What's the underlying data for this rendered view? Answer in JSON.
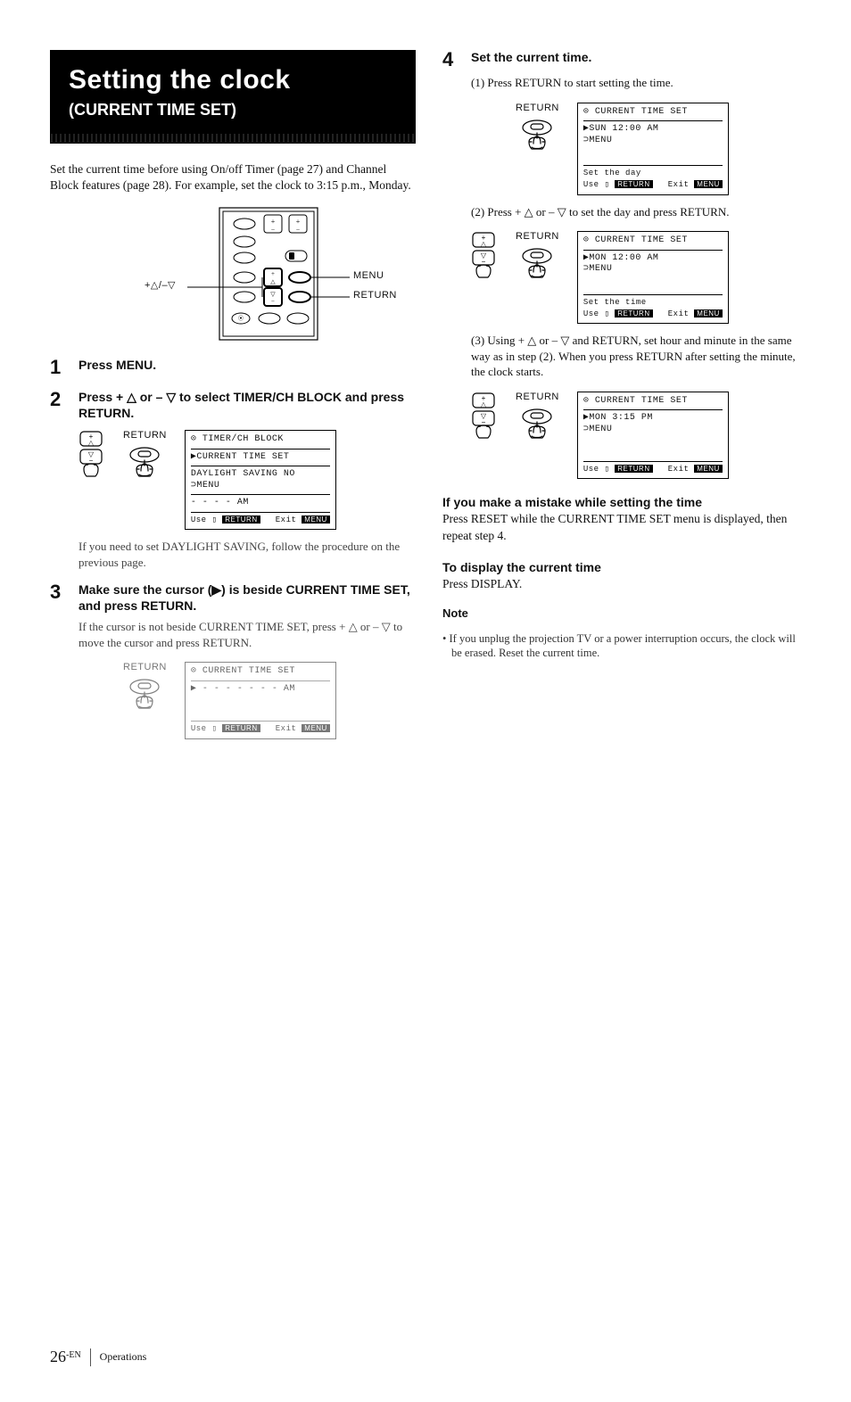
{
  "banner": {
    "title": "Setting the clock",
    "subtitle": "(CURRENT TIME SET)"
  },
  "intro": "Set the current time before using On/off Timer (page 27) and Channel Block features (page 28). For example, set the clock to 3:15 p.m., Monday.",
  "remote_labels": {
    "menu": "MENU",
    "return": "RETURN",
    "arrows": "+△/–▽"
  },
  "steps": {
    "s1": {
      "num": "1",
      "head": "Press MENU."
    },
    "s2": {
      "num": "2",
      "head": "Press + △ or – ▽ to select TIMER/CH BLOCK and press RETURN.",
      "screen": {
        "title": "⊙ TIMER/CH BLOCK",
        "l1": "▶CURRENT TIME SET",
        "l2": "DAYLIGHT SAVING NO",
        "l3": "⊃MENU",
        "l4": "- - - - AM",
        "foot_use": "Use ▯ ",
        "foot_use_badge": "RETURN",
        "foot_exit": "Exit ",
        "foot_exit_badge": "MENU"
      },
      "after": "If you need to set DAYLIGHT SAVING, follow the procedure on the previous page."
    },
    "s3": {
      "num": "3",
      "head": "Make sure the cursor (▶) is beside CURRENT TIME SET, and press RETURN.",
      "body": "If the cursor is not beside CURRENT TIME SET, press + △ or – ▽ to move the cursor and press RETURN.",
      "screen": {
        "title": "⊙ CURRENT TIME SET",
        "l1": "▶ - - - - - - - AM",
        "foot_use": "Use ▯ ",
        "foot_use_badge": "RETURN",
        "foot_exit": "Exit ",
        "foot_exit_badge": "MENU"
      }
    },
    "s4": {
      "num": "4",
      "head": "Set the current time.",
      "p1": "(1) Press RETURN to start setting the time.",
      "screen1": {
        "title": "⊙ CURRENT TIME SET",
        "l1": "▶SUN 12:00 AM",
        "l2": " ⊃MENU",
        "hint": "Set the day",
        "foot_use": "Use ▯ ",
        "foot_use_badge": "RETURN",
        "foot_exit": "Exit ",
        "foot_exit_badge": "MENU"
      },
      "p2": "(2) Press + △ or – ▽ to set the day and press RETURN.",
      "screen2": {
        "title": "⊙ CURRENT TIME SET",
        "l1": "▶MON 12:00 AM",
        "l2": " ⊃MENU",
        "hint": "Set the time",
        "foot_use": "Use ▯ ",
        "foot_use_badge": "RETURN",
        "foot_exit": "Exit ",
        "foot_exit_badge": "MENU"
      },
      "p3": "(3) Using + △ or – ▽ and RETURN, set hour and minute in the same way as in step (2). When you press RETURN after setting the minute, the clock starts.",
      "screen3": {
        "title": "⊙ CURRENT TIME SET",
        "l1": "▶MON  3:15 PM",
        "l2": " ⊃MENU",
        "foot_use": "Use ▯ ",
        "foot_use_badge": "RETURN",
        "foot_exit": "Exit ",
        "foot_exit_badge": "MENU"
      }
    }
  },
  "mistake": {
    "h": "If you make a mistake while setting the time",
    "b": "Press RESET while the CURRENT TIME SET menu is displayed, then repeat step 4."
  },
  "display": {
    "h": "To display the current time",
    "b": "Press DISPLAY."
  },
  "note": {
    "h": "Note",
    "b": "• If you unplug the projection TV or a power interruption occurs, the clock will be erased. Reset the current time."
  },
  "labels": {
    "return": "RETURN"
  },
  "footer": {
    "page": "26",
    "sup": "-EN",
    "section": "Operations"
  }
}
